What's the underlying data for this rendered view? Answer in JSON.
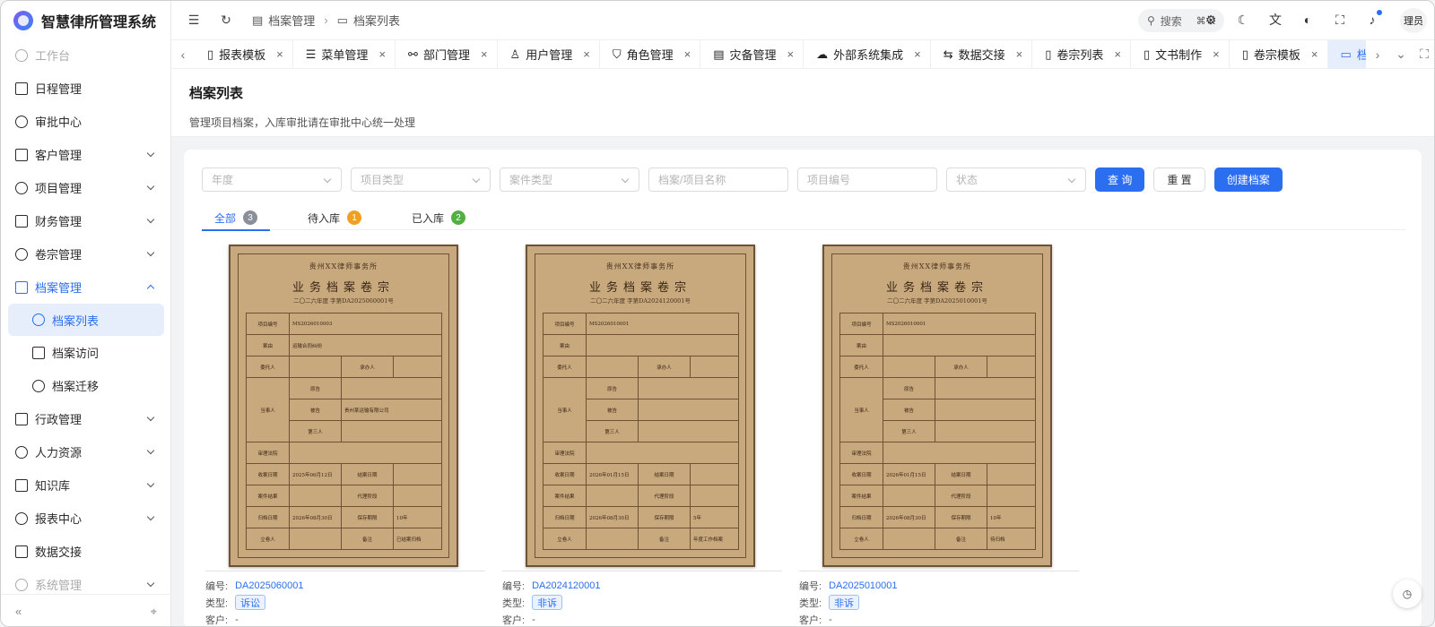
{
  "app": {
    "title": "智慧律所管理系统"
  },
  "sidebar": {
    "items": [
      {
        "label": "工作台",
        "faded": true
      },
      {
        "label": "日程管理"
      },
      {
        "label": "审批中心"
      },
      {
        "label": "客户管理",
        "caret": true
      },
      {
        "label": "项目管理",
        "caret": true
      },
      {
        "label": "财务管理",
        "caret": true
      },
      {
        "label": "卷宗管理",
        "caret": true
      },
      {
        "label": "档案管理",
        "caret": true,
        "expanded": true
      },
      {
        "label": "档案列表",
        "sub": true,
        "active": true
      },
      {
        "label": "档案访问",
        "sub": true
      },
      {
        "label": "档案迁移",
        "sub": true
      },
      {
        "label": "行政管理",
        "caret": true
      },
      {
        "label": "人力资源",
        "caret": true
      },
      {
        "label": "知识库",
        "caret": true
      },
      {
        "label": "报表中心",
        "caret": true
      },
      {
        "label": "数据交接"
      },
      {
        "label": "系统管理",
        "caret": true,
        "faded": true
      }
    ]
  },
  "header": {
    "breadcrumb": [
      "档案管理",
      "档案列表"
    ],
    "search_label": "搜索",
    "search_shortcut": "⌘ K",
    "user": "理员"
  },
  "tabs": [
    {
      "label": "报表模板",
      "icon": "document-icon"
    },
    {
      "label": "菜单管理",
      "icon": "list-icon"
    },
    {
      "label": "部门管理",
      "icon": "org-icon"
    },
    {
      "label": "用户管理",
      "icon": "user-icon"
    },
    {
      "label": "角色管理",
      "icon": "shield-icon"
    },
    {
      "label": "灾备管理",
      "icon": "database-icon"
    },
    {
      "label": "外部系统集成",
      "icon": "cloud-icon"
    },
    {
      "label": "数据交接",
      "icon": "exchange-icon"
    },
    {
      "label": "卷宗列表",
      "icon": "document-icon"
    },
    {
      "label": "文书制作",
      "icon": "document-add-icon"
    },
    {
      "label": "卷宗模板",
      "icon": "document-icon"
    },
    {
      "label": "档案列表",
      "icon": "folder-icon",
      "active": true
    }
  ],
  "page": {
    "title": "档案列表",
    "subtitle": "管理项目档案，入库审批请在审批中心统一处理"
  },
  "filters": {
    "year": "年度",
    "project_type": "项目类型",
    "case_type": "案件类型",
    "name": "档案/项目名称",
    "project_no": "项目编号",
    "status": "状态",
    "query": "查 询",
    "reset": "重 置",
    "create": "创建档案"
  },
  "status_tabs": [
    {
      "label": "全部",
      "count": "3",
      "color": "#8a8f99",
      "active": true
    },
    {
      "label": "待入库",
      "count": "1",
      "color": "#f0a020"
    },
    {
      "label": "已入库",
      "count": "2",
      "color": "#52b043"
    }
  ],
  "archives": [
    {
      "firm": "贵州XX律师事务所",
      "title": "业务档案卷宗",
      "no_line": "二〇二六年度 字第DA2025060001号",
      "project_no": "MS2026010003",
      "cause": "运输合同纠纷",
      "defendant": "贵州某运输有限公司",
      "close_date": "2025年06月12日",
      "archive_date": "2026年08月30日",
      "period": "10年",
      "remark": "已结案归档",
      "code": "DA2025060001",
      "type": "诉讼",
      "client": "-"
    },
    {
      "firm": "贵州XX律师事务所",
      "title": "业务档案卷宗",
      "no_line": "二〇二六年度 字第DA2024120001号",
      "project_no": "MS2026010001",
      "cause": "",
      "defendant": "",
      "close_date": "2026年01月15日",
      "archive_date": "2026年08月30日",
      "period": "5年",
      "remark": "年度工作档案",
      "code": "DA2024120001",
      "type": "非诉",
      "client": "-"
    },
    {
      "firm": "贵州XX律师事务所",
      "title": "业务档案卷宗",
      "no_line": "二〇二六年度 字第DA2025010001号",
      "project_no": "MS2026010001",
      "cause": "",
      "defendant": "",
      "close_date": "2026年01月15日",
      "archive_date": "2026年08月30日",
      "period": "10年",
      "remark": "待归档",
      "code": "DA2025010001",
      "type": "非诉",
      "client": "-"
    }
  ],
  "cover_labels": {
    "project_no": "项目编号",
    "cause": "案由",
    "client": "委托人",
    "handler": "承办人",
    "party": "当事人",
    "plaintiff": "原告",
    "defendant": "被告",
    "third": "第三人",
    "court": "审理法院",
    "close_date": "收案日期",
    "end_date": "结案日期",
    "result": "案件结果",
    "stage": "代理阶段",
    "archive_date": "归档日期",
    "period": "保存期限",
    "filer": "立卷人",
    "remark": "备注"
  },
  "meta_labels": {
    "code": "编号:",
    "type": "类型:",
    "client": "客户:"
  }
}
